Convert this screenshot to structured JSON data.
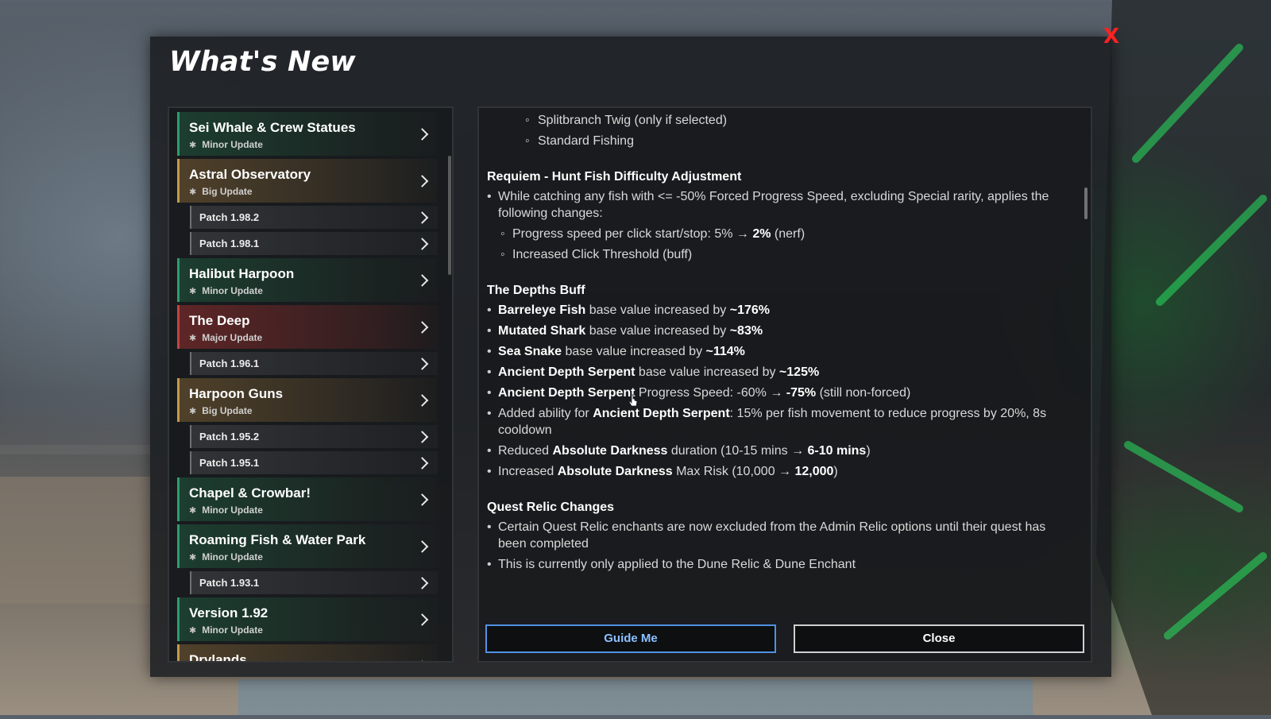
{
  "window": {
    "title": "What's New",
    "close_label": "X"
  },
  "colors": {
    "minor": "#2f9c6b",
    "big": "#c49a4a",
    "major": "#c04545",
    "accent_blue": "#4f92e2",
    "close_red": "#ff2121"
  },
  "sidebar": {
    "items": [
      {
        "kind": "update",
        "variant": "minor",
        "title": "Sei Whale & Crew Statues",
        "tag": "Minor Update"
      },
      {
        "kind": "update",
        "variant": "big",
        "title": "Astral Observatory",
        "tag": "Big Update"
      },
      {
        "kind": "patch",
        "title": "Patch 1.98.2"
      },
      {
        "kind": "patch",
        "title": "Patch 1.98.1"
      },
      {
        "kind": "update",
        "variant": "minor",
        "title": "Halibut Harpoon",
        "tag": "Minor Update"
      },
      {
        "kind": "update",
        "variant": "major",
        "title": "The Deep",
        "tag": "Major Update"
      },
      {
        "kind": "patch",
        "title": "Patch 1.96.1"
      },
      {
        "kind": "update",
        "variant": "big",
        "title": "Harpoon Guns",
        "tag": "Big Update"
      },
      {
        "kind": "patch",
        "title": "Patch 1.95.2"
      },
      {
        "kind": "patch",
        "title": "Patch 1.95.1"
      },
      {
        "kind": "update",
        "variant": "minor",
        "title": "Chapel & Crowbar!",
        "tag": "Minor Update"
      },
      {
        "kind": "update",
        "variant": "minor",
        "title": "Roaming Fish & Water Park",
        "tag": "Minor Update"
      },
      {
        "kind": "patch",
        "title": "Patch 1.93.1"
      },
      {
        "kind": "update",
        "variant": "minor",
        "title": "Version 1.92",
        "tag": "Minor Update"
      },
      {
        "kind": "update",
        "variant": "big",
        "title": "Drylands",
        "tag": ""
      }
    ]
  },
  "content": {
    "sections": [
      {
        "heading": "",
        "bullets": [
          {
            "level": 2,
            "parts": [
              {
                "t": "Splitbranch Twig (only if selected)"
              }
            ]
          },
          {
            "level": 2,
            "parts": [
              {
                "t": "Standard Fishing"
              }
            ]
          }
        ]
      },
      {
        "heading": "Requiem - Hunt Fish Difficulty Adjustment",
        "bullets": [
          {
            "level": 0,
            "parts": [
              {
                "t": "While catching any fish with <= -50% Forced Progress Speed, excluding Special rarity, applies the following changes:"
              }
            ]
          },
          {
            "level": 1,
            "parts": [
              {
                "t": "Progress speed per click start/stop: 5% → "
              },
              {
                "t": "2%",
                "b": true
              },
              {
                "t": " (nerf)"
              }
            ]
          },
          {
            "level": 1,
            "parts": [
              {
                "t": "Increased Click Threshold (buff)"
              }
            ]
          }
        ]
      },
      {
        "heading": "The Depths Buff",
        "bullets": [
          {
            "level": 0,
            "parts": [
              {
                "t": "Barreleye Fish",
                "b": true
              },
              {
                "t": " base value increased by "
              },
              {
                "t": "~176%",
                "b": true
              }
            ]
          },
          {
            "level": 0,
            "parts": [
              {
                "t": "Mutated Shark",
                "b": true
              },
              {
                "t": " base value increased by "
              },
              {
                "t": "~83%",
                "b": true
              }
            ]
          },
          {
            "level": 0,
            "parts": [
              {
                "t": "Sea Snake",
                "b": true
              },
              {
                "t": " base value increased by "
              },
              {
                "t": "~114%",
                "b": true
              }
            ]
          },
          {
            "level": 0,
            "parts": [
              {
                "t": "Ancient Depth Serpent",
                "b": true
              },
              {
                "t": " base value increased by "
              },
              {
                "t": "~125%",
                "b": true
              }
            ]
          },
          {
            "level": 0,
            "parts": [
              {
                "t": "Ancient Depth Serpent",
                "b": true
              },
              {
                "t": " Progress Speed: -60% → "
              },
              {
                "t": "-75%",
                "b": true
              },
              {
                "t": " (still non-forced)"
              }
            ]
          },
          {
            "level": 0,
            "parts": [
              {
                "t": "Added ability for "
              },
              {
                "t": "Ancient Depth Serpent",
                "b": true
              },
              {
                "t": ": 15% per fish movement to reduce progress by 20%, 8s cooldown"
              }
            ]
          },
          {
            "level": 0,
            "parts": [
              {
                "t": "Reduced "
              },
              {
                "t": "Absolute Darkness",
                "b": true
              },
              {
                "t": " duration (10-15 mins → "
              },
              {
                "t": "6-10 mins",
                "b": true
              },
              {
                "t": ")"
              }
            ]
          },
          {
            "level": 0,
            "parts": [
              {
                "t": "Increased "
              },
              {
                "t": "Absolute Darkness",
                "b": true
              },
              {
                "t": " Max Risk (10,000 → "
              },
              {
                "t": "12,000",
                "b": true
              },
              {
                "t": ")"
              }
            ]
          }
        ]
      },
      {
        "heading": "Quest Relic Changes",
        "bullets": [
          {
            "level": 0,
            "parts": [
              {
                "t": "Certain Quest Relic enchants are now excluded from the Admin Relic options until their quest has been completed"
              }
            ]
          },
          {
            "level": 0,
            "parts": [
              {
                "t": "This is currently only applied to the Dune Relic & Dune Enchant"
              }
            ]
          }
        ]
      }
    ]
  },
  "buttons": {
    "guide": "Guide Me",
    "close": "Close"
  }
}
